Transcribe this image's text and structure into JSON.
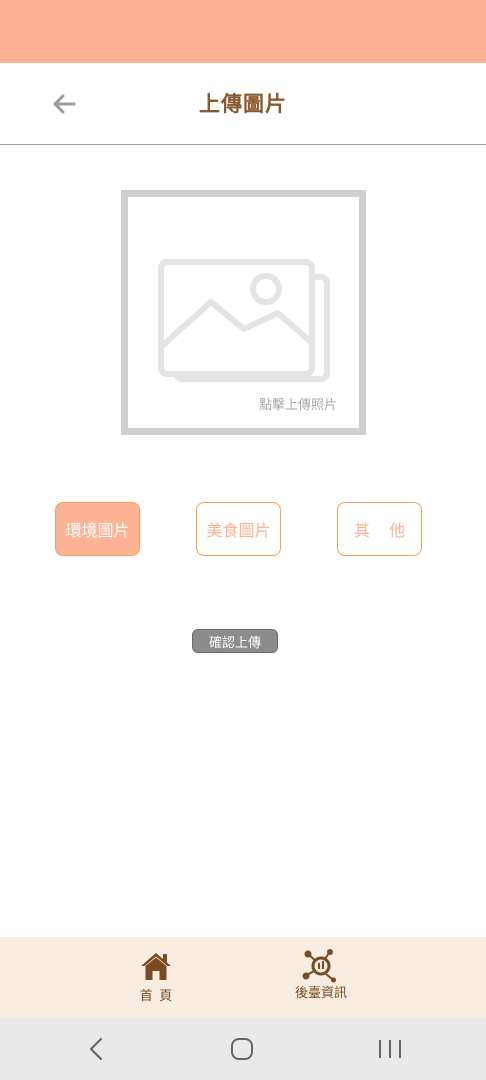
{
  "header": {
    "title": "上傳圖片",
    "back_icon": "arrow-left-icon"
  },
  "upload": {
    "hint": "點擊上傳照片",
    "icon": "image-placeholder-icon"
  },
  "categories": [
    {
      "label": "環境圖片",
      "selected": true
    },
    {
      "label": "美食圖片",
      "selected": false
    },
    {
      "label": "其他",
      "selected": false
    }
  ],
  "confirm": {
    "label": "確認上傳"
  },
  "bottom_nav": {
    "items": [
      {
        "label": "首頁",
        "icon": "home-icon"
      },
      {
        "label": "後臺資訊",
        "icon": "network-search-icon"
      }
    ]
  },
  "system_nav": {
    "icons": [
      "back-chevron-icon",
      "home-outline-icon",
      "recent-apps-icon"
    ]
  },
  "colors": {
    "status_bar": "#ffb394",
    "accent": "#ffb394",
    "title_brown": "#8a5a2e",
    "button_border": "#f4a25a",
    "nav_background": "#f9ece1",
    "confirm_gray": "#8c8c8c"
  }
}
